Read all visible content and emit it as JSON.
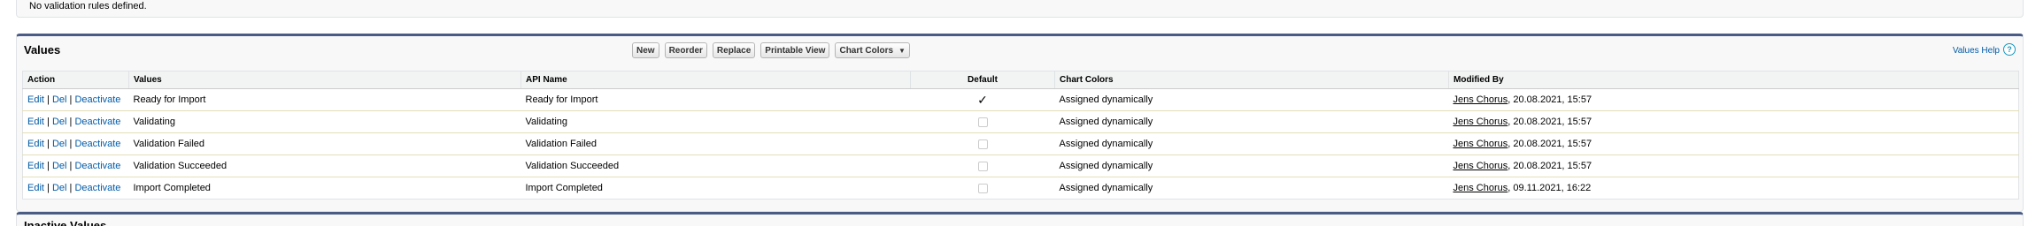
{
  "validation_rules": {
    "empty_message": "No validation rules defined."
  },
  "values_section": {
    "title": "Values",
    "buttons": {
      "new": "New",
      "reorder": "Reorder",
      "replace": "Replace",
      "printable_view": "Printable View",
      "chart_colors": "Chart Colors"
    },
    "help_link": "Values Help",
    "help_icon": "?",
    "columns": [
      "Action",
      "Values",
      "API Name",
      "Default",
      "Chart Colors",
      "Modified By"
    ],
    "action_labels": {
      "edit": "Edit",
      "del": "Del",
      "deactivate": "Deactivate",
      "separator": "|"
    },
    "rows": [
      {
        "value": "Ready for Import",
        "api_name": "Ready for Import",
        "default": true,
        "default_mark": "✓",
        "chart_color": "Assigned dynamically",
        "modified_user": "Jens Chorus",
        "modified_date": ", 20.08.2021, 15:57"
      },
      {
        "value": "Validating",
        "api_name": "Validating",
        "default": false,
        "default_mark": "",
        "chart_color": "Assigned dynamically",
        "modified_user": "Jens Chorus",
        "modified_date": ", 20.08.2021, 15:57"
      },
      {
        "value": "Validation Failed",
        "api_name": "Validation Failed",
        "default": false,
        "default_mark": "",
        "chart_color": "Assigned dynamically",
        "modified_user": "Jens Chorus",
        "modified_date": ", 20.08.2021, 15:57"
      },
      {
        "value": "Validation Succeeded",
        "api_name": "Validation Succeeded",
        "default": false,
        "default_mark": "",
        "chart_color": "Assigned dynamically",
        "modified_user": "Jens Chorus",
        "modified_date": ", 20.08.2021, 15:57"
      },
      {
        "value": "Import Completed",
        "api_name": "Import Completed",
        "default": false,
        "default_mark": "",
        "chart_color": "Assigned dynamically",
        "modified_user": "Jens Chorus",
        "modified_date": ", 09.11.2021, 16:22"
      }
    ]
  },
  "inactive_section": {
    "title": "Inactive Values"
  },
  "colors": {
    "accent": "#4a5c85",
    "link": "#015ba7"
  }
}
